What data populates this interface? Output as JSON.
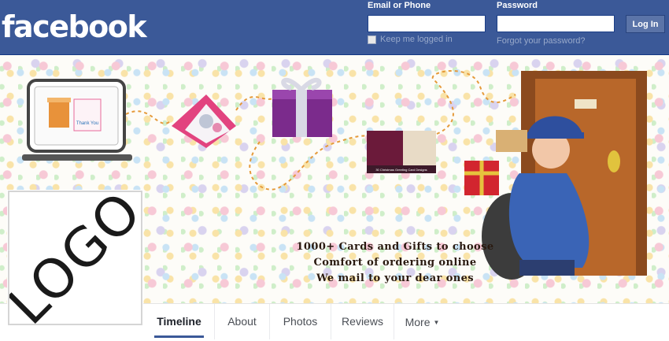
{
  "header": {
    "logo_text": "facebook",
    "email_label": "Email or Phone",
    "email_value": "",
    "password_label": "Password",
    "password_value": "",
    "keep_logged_in_label": "Keep me logged in",
    "keep_logged_in_checked": false,
    "forgot_password_label": "Forgot your password?",
    "login_button_label": "Log In",
    "bar_color": "#3b5998"
  },
  "cover": {
    "tagline": [
      "1000+ Cards and Gifts to choose",
      "Comfort of ordering online",
      "We mail to your dear ones"
    ],
    "laptop_card_text": "Thank You",
    "card_book_text": "30 Christmas Greeting Card Designs",
    "illustrations": [
      "laptop-icon",
      "greeting-card-icon",
      "gift-box-icon",
      "card-book-icon",
      "postman-icon",
      "door-icon"
    ]
  },
  "profile": {
    "logo_text": "LOGO"
  },
  "nav": {
    "tabs": [
      {
        "label": "Timeline",
        "active": true
      },
      {
        "label": "About",
        "active": false
      },
      {
        "label": "Photos",
        "active": false
      },
      {
        "label": "Reviews",
        "active": false
      },
      {
        "label": "More",
        "active": false
      }
    ],
    "active_color": "#3b5998"
  }
}
